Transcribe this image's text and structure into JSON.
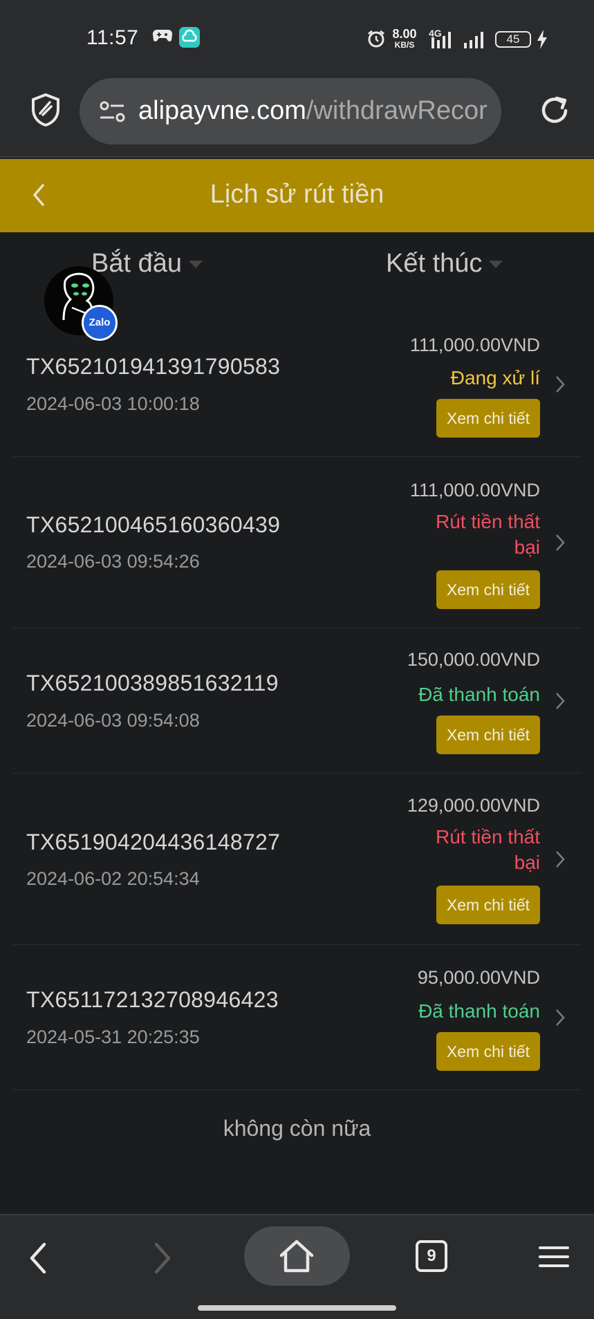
{
  "status_bar": {
    "time": "11:57",
    "net_speed_value": "8.00",
    "net_speed_unit": "KB/S",
    "network": "4G",
    "battery": "45",
    "icons": [
      "game-controller-icon",
      "cloud-app-icon",
      "alarm-icon",
      "signal-icon",
      "charging-icon"
    ]
  },
  "browser": {
    "url_host": "alipayvne.com",
    "url_path": "/withdrawRecor",
    "icons": [
      "shield-icon",
      "site-settings-icon",
      "reload-icon"
    ]
  },
  "header": {
    "title": "Lịch sử rút tiền",
    "accent_color": "#ad8b00"
  },
  "filters": {
    "start_label": "Bắt đầu",
    "end_label": "Kết thúc"
  },
  "overlay": {
    "zalo_label": "Zalo"
  },
  "records": [
    {
      "id": "TX652101941391790583",
      "date": "2024-06-03 10:00:18",
      "amount": "111,000.00VND",
      "status_lines": [
        "Đang xử lí"
      ],
      "status_color": "#f0c542",
      "button": "Xem chi tiết"
    },
    {
      "id": "TX652100465160360439",
      "date": "2024-06-03 09:54:26",
      "amount": "111,000.00VND",
      "status_lines": [
        "Rút tiền thất",
        "bại"
      ],
      "status_color": "#ee5060",
      "button": "Xem chi tiết"
    },
    {
      "id": "TX652100389851632119",
      "date": "2024-06-03 09:54:08",
      "amount": "150,000.00VND",
      "status_lines": [
        "Đã thanh toán"
      ],
      "status_color": "#4fcf8c",
      "button": "Xem chi tiết"
    },
    {
      "id": "TX651904204436148727",
      "date": "2024-06-02 20:54:34",
      "amount": "129,000.00VND",
      "status_lines": [
        "Rút tiền thất",
        "bại"
      ],
      "status_color": "#ee5060",
      "button": "Xem chi tiết"
    },
    {
      "id": "TX651172132708946423",
      "date": "2024-05-31 20:25:35",
      "amount": "95,000.00VND",
      "status_lines": [
        "Đã thanh toán"
      ],
      "status_color": "#4fcf8c",
      "button": "Xem chi tiết"
    }
  ],
  "footer_text": "không còn nữa",
  "bottom_nav": {
    "tab_count": "9",
    "icons": [
      "back-icon",
      "forward-icon",
      "home-icon",
      "tabs-icon",
      "menu-icon"
    ]
  }
}
